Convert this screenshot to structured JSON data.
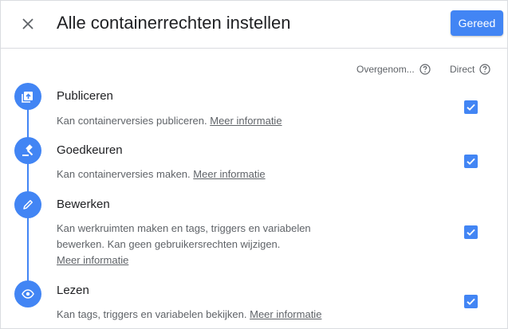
{
  "dialog": {
    "title": "Alle containerrechten instellen",
    "done_label": "Gereed"
  },
  "columns": {
    "inherited_label": "Overgenom...",
    "direct_label": "Direct"
  },
  "permissions": [
    {
      "title": "Publiceren",
      "description": "Kan containerversies publiceren.",
      "link": "Meer informatie",
      "icon": "publish-icon",
      "direct_checked": true
    },
    {
      "title": "Goedkeuren",
      "description": "Kan containerversies maken.",
      "link": "Meer informatie",
      "icon": "gavel-icon",
      "direct_checked": true
    },
    {
      "title": "Bewerken",
      "description": "Kan werkruimten maken en tags, triggers en variabelen bewerken. Kan geen gebruikersrechten wijzigen.",
      "link": "Meer informatie",
      "icon": "pencil-icon",
      "direct_checked": true
    },
    {
      "title": "Lezen",
      "description": "Kan tags, triggers en variabelen bekijken.",
      "link": "Meer informatie",
      "icon": "eye-icon",
      "direct_checked": true
    }
  ],
  "colors": {
    "accent": "#4285f4",
    "text_primary": "#202124",
    "text_secondary": "#5f6368",
    "divider": "#dadce0"
  }
}
